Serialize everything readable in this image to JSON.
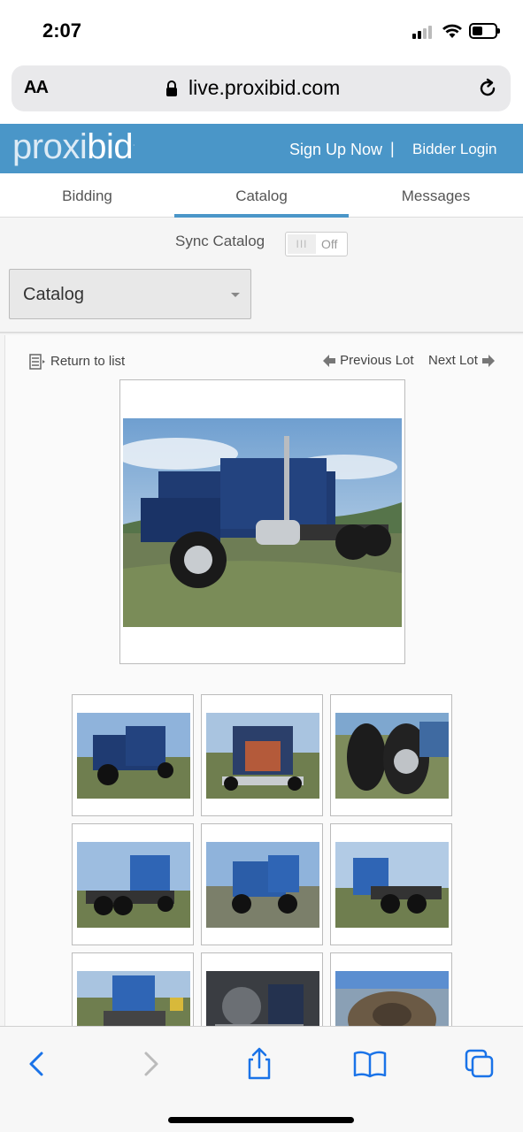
{
  "status_bar": {
    "time": "2:07"
  },
  "browser": {
    "aa_label": "AA",
    "url": "live.proxibid.com"
  },
  "site": {
    "logo_light": "proxi",
    "logo_bold": "bid",
    "signup_label": "Sign Up Now",
    "separator": "|",
    "login_label": "Bidder Login",
    "brand_color": "#4a96c8"
  },
  "tabs": [
    {
      "label": "Bidding"
    },
    {
      "label": "Catalog"
    },
    {
      "label": "Messages"
    }
  ],
  "sync": {
    "label": "Sync Catalog",
    "toggle_bars": "III",
    "toggle_state": "Off"
  },
  "catalog_select": {
    "value": "Catalog"
  },
  "lot_nav": {
    "return_label": "Return to list",
    "previous_label": "Previous Lot",
    "next_label": "Next Lot"
  },
  "photos": {
    "main": "blue semi truck, side view",
    "thumbnails": [
      "blue semi truck, side view",
      "blue semi truck, front grille",
      "rear dual wheels",
      "blue truck, rear three-quarter view",
      "blue truck, side view",
      "blue truck, rear three-quarter view",
      "truck cab rear",
      "engine components",
      "fifth wheel hitch"
    ]
  }
}
